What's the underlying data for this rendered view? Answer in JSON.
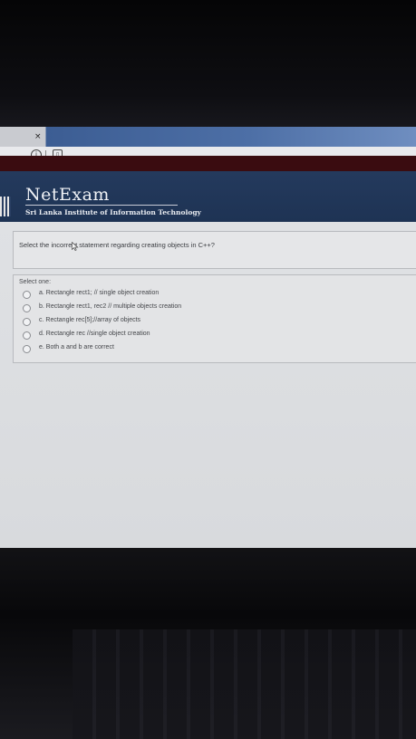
{
  "browser": {
    "tab_close_glyph": "×",
    "info_glyph": "i",
    "page_glyph": "▯"
  },
  "header": {
    "brand": "NetExam",
    "institute": "Sri Lanka Institute of Information Technology"
  },
  "question": {
    "text": "Select the incorrect statement regarding creating objects in C++?",
    "prompt": "Select one:",
    "options": [
      {
        "label": "a. Rectangle rect1; // single object creation"
      },
      {
        "label": "b. Rectangle rect1, rec2 // multiple objects creation"
      },
      {
        "label": "c. Rectangle rec[5];//array of objects"
      },
      {
        "label": "d. Rectangle rec //single object creation"
      },
      {
        "label": "e. Both a and b are correct"
      }
    ]
  },
  "colors": {
    "header_bg": "#243a5d",
    "accent_band": "#3a0c10",
    "tab_strip": "#4d6fa6"
  }
}
